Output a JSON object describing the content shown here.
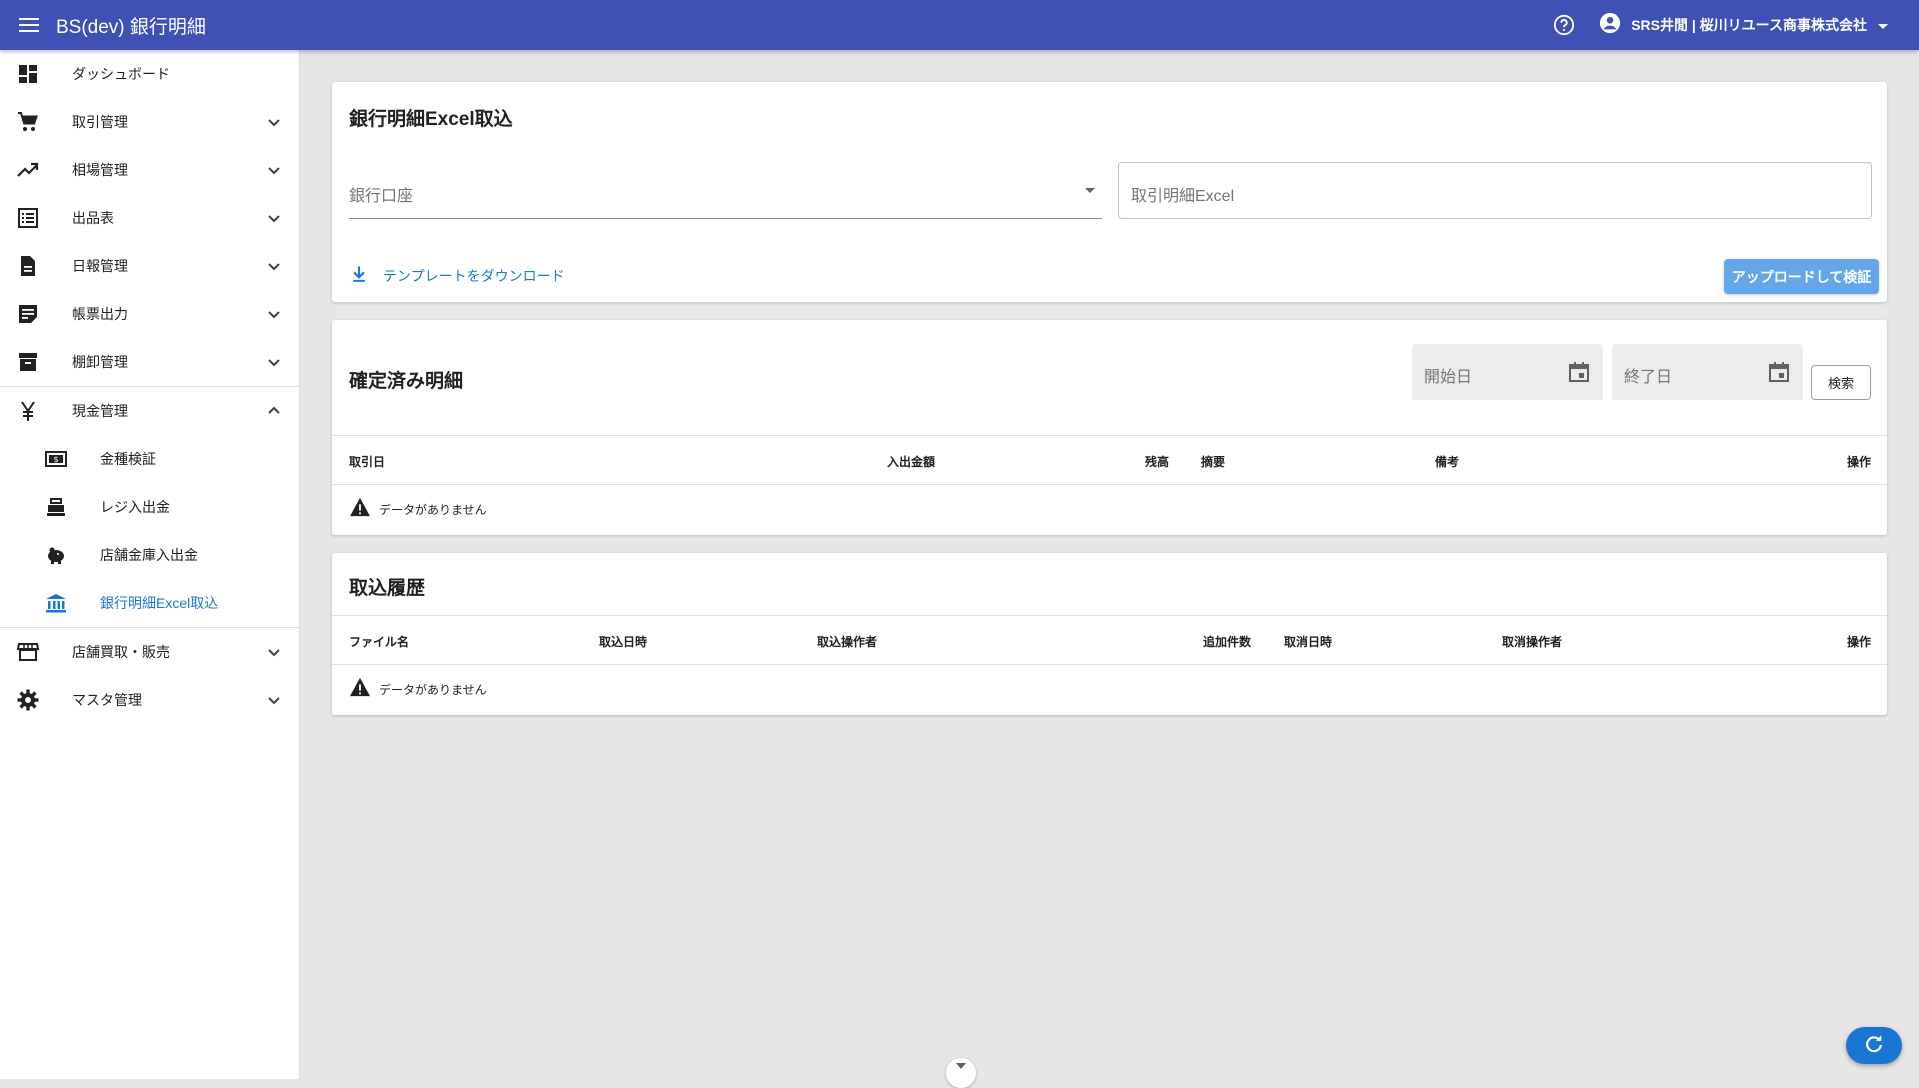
{
  "app": {
    "title": "BS(dev) 銀行明細",
    "user_name": "SRS井閒 | 桜川リユース商事株式会社"
  },
  "sidebar": {
    "items": [
      {
        "label": "ダッシュボード",
        "icon": "dashboard-icon",
        "expandable": false
      },
      {
        "label": "取引管理",
        "icon": "shopping-cart-icon",
        "expandable": true
      },
      {
        "label": "相場管理",
        "icon": "trending-up-icon",
        "expandable": true
      },
      {
        "label": "出品表",
        "icon": "list-icon",
        "expandable": true
      },
      {
        "label": "日報管理",
        "icon": "document-icon",
        "expandable": true
      },
      {
        "label": "帳票出力",
        "icon": "note-icon",
        "expandable": true
      },
      {
        "label": "棚卸管理",
        "icon": "archive-icon",
        "expandable": true
      },
      {
        "label": "現金管理",
        "icon": "yen-icon",
        "expandable": true,
        "expanded": true
      }
    ],
    "sub_items": [
      {
        "label": "金種検証",
        "icon": "money-icon"
      },
      {
        "label": "レジ入出金",
        "icon": "cash-register-icon"
      },
      {
        "label": "店舗金庫入出金",
        "icon": "piggy-bank-icon"
      },
      {
        "label": "銀行明細Excel取込",
        "icon": "bank-icon",
        "active": true
      }
    ],
    "bottom_items": [
      {
        "label": "店舗買取・販売",
        "icon": "store-icon",
        "expandable": true
      },
      {
        "label": "マスタ管理",
        "icon": "gear-icon",
        "expandable": true
      }
    ]
  },
  "import_card": {
    "title": "銀行明細Excel取込",
    "bank_account_placeholder": "銀行口座",
    "excel_placeholder": "取引明細Excel",
    "download_label": "テンプレートをダウンロード",
    "upload_label": "アップロードして検証"
  },
  "confirmed_card": {
    "title": "確定済み明細",
    "start_date_placeholder": "開始日",
    "end_date_placeholder": "終了日",
    "search_label": "検索",
    "columns": [
      "取引日",
      "入出金額",
      "残高",
      "摘要",
      "備考",
      "操作"
    ],
    "no_data": "データがありません"
  },
  "history_card": {
    "title": "取込履歴",
    "columns": [
      "ファイル名",
      "取込日時",
      "取込操作者",
      "追加件数",
      "取消日時",
      "取消操作者",
      "操作"
    ],
    "no_data": "データがありません"
  },
  "colors": {
    "appbar": "#3f51b5",
    "active": "#1976d2",
    "upload_button": "#64a6e8"
  }
}
